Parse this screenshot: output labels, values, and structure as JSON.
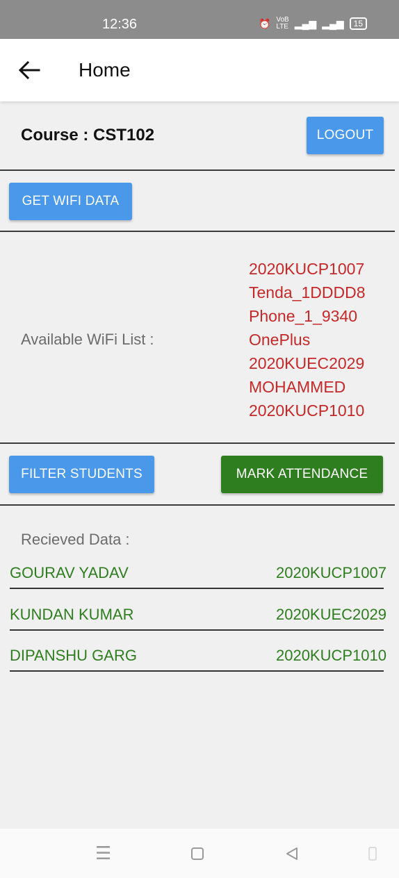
{
  "status_bar": {
    "time": "12:36",
    "icons": [
      "alarm-icon",
      "volte-icon",
      "5g-signal-icon",
      "signal-icon",
      "battery-icon"
    ],
    "battery_level": "15"
  },
  "app_bar": {
    "title": "Home",
    "back_icon": "arrow-left-icon"
  },
  "course": {
    "label": "Course : CST102"
  },
  "buttons": {
    "logout": "LOGOUT",
    "get_wifi": "GET WIFI DATA",
    "filter_students": "FILTER STUDENTS",
    "mark_attendance": "MARK ATTENDANCE"
  },
  "wifi": {
    "label": "Available WiFi List :",
    "networks": [
      "2020KUCP1007",
      "Tenda_1DDDD8",
      "Phone_1_9340",
      "OnePlus",
      "2020KUEC2029",
      "MOHAMMED",
      "2020KUCP1010"
    ]
  },
  "received": {
    "label": "Recieved Data :",
    "students": [
      {
        "name": "GOURAV YADAV",
        "id": "2020KUCP1007"
      },
      {
        "name": "KUNDAN KUMAR",
        "id": "2020KUEC2029"
      },
      {
        "name": "DIPANSHU GARG",
        "id": "2020KUCP1010"
      }
    ]
  },
  "colors": {
    "primary_button": "#4a98e9",
    "attendance_button": "#2e7d1e",
    "wifi_text": "#c62828",
    "student_text": "#2e7d1e"
  },
  "nav_bar": {
    "icons": [
      "menu-icon",
      "home-icon",
      "back-icon",
      "rotate-icon"
    ]
  }
}
